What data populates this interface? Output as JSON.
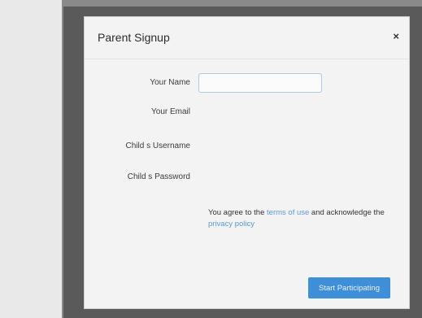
{
  "modal": {
    "title": "Parent Signup",
    "close_symbol": "×",
    "fields": {
      "name_label": "Your Name",
      "name_value": "",
      "email_label": "Your Email",
      "email_value": "",
      "username_label": "Child s Username",
      "username_value": "",
      "password_label": "Child s Password",
      "password_value": ""
    },
    "agreement": {
      "prefix": "You agree to the ",
      "terms_link": "terms of use",
      "middle": " and acknowledge the ",
      "privacy_link": "privacy policy"
    },
    "submit_label": "Start Participating"
  },
  "colors": {
    "accent": "#3f8fd8",
    "link": "#5a9bd6",
    "overlay": "#5a5a5a"
  }
}
